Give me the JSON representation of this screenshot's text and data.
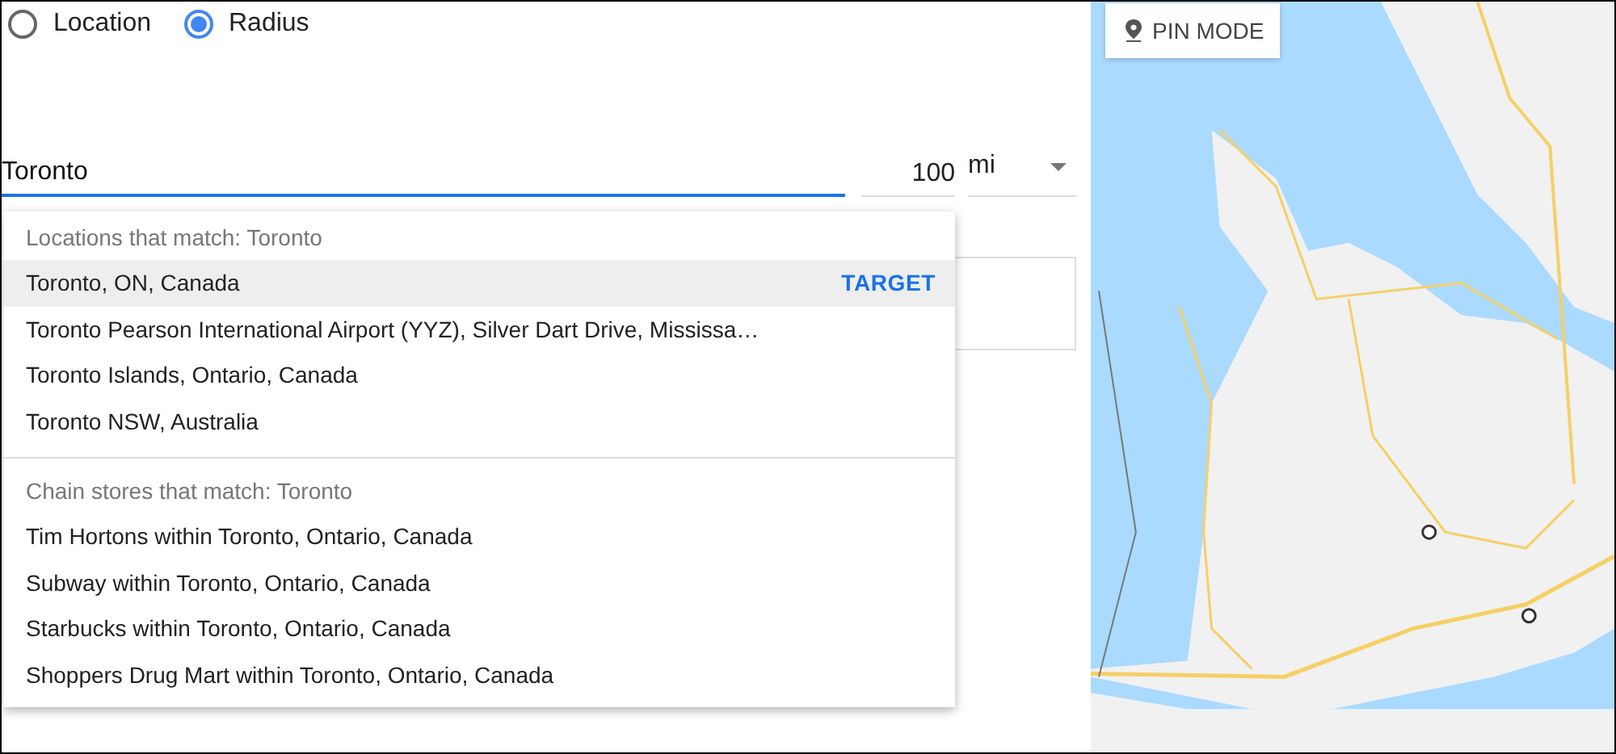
{
  "mode_options": [
    {
      "label": "Location",
      "selected": false
    },
    {
      "label": "Radius",
      "selected": true
    }
  ],
  "search": {
    "value": "Toronto",
    "focused": true
  },
  "radius": {
    "value": "100",
    "unit": "mi"
  },
  "suggestions": [
    {
      "heading": "Locations that match: Toronto",
      "items": [
        {
          "label": "Toronto, ON, Canada",
          "selected": true,
          "action": "TARGET"
        },
        {
          "label": "Toronto Pearson International Airport (YYZ), Silver Dart Drive, Mississa…",
          "selected": false
        },
        {
          "label": "Toronto Islands, Ontario, Canada",
          "selected": false
        },
        {
          "label": "Toronto NSW, Australia",
          "selected": false
        }
      ]
    },
    {
      "heading": "Chain stores that match: Toronto",
      "items": [
        {
          "label": "Tim Hortons within Toronto, Ontario, Canada",
          "selected": false
        },
        {
          "label": "Subway within Toronto, Ontario, Canada",
          "selected": false
        },
        {
          "label": "Starbucks within Toronto, Ontario, Canada",
          "selected": false
        },
        {
          "label": "Shoppers Drug Mart within Toronto, Ontario, Canada",
          "selected": false
        }
      ]
    }
  ],
  "map": {
    "kind": "picture",
    "pin_mode_button": "PIN MODE"
  }
}
